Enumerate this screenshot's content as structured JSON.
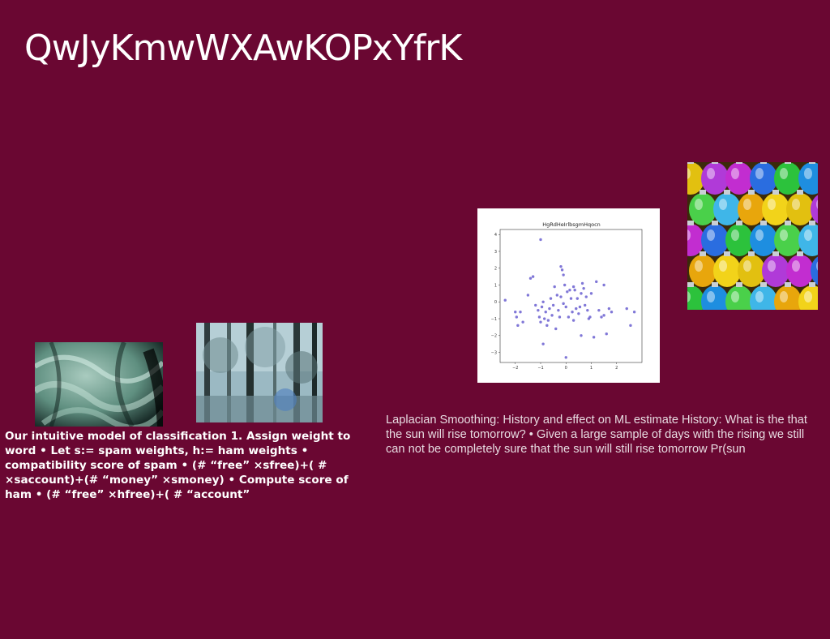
{
  "slide": {
    "title": "QwJyKmwWXAwKOPxYfrK",
    "text_left": "Our intuitive model of classification 1. Assign weight to word • Let s:= spam weights, h:= ham weights • compatibility score of spam • (# “free” ×sfree)+( # ×saccount)+(# “money” ×smoney) • Compute score of ham • (# “free” ×hfree)+( # “account”",
    "text_right": "Laplacian Smoothing: History and effect on ML estimate History: What is the that the sun will rise tomorrow? • Given a large sample of days with the rising we still can not be completely sure that the sun will still rise tomorrow Pr(sun"
  },
  "colors": {
    "background": "#6a0732",
    "scatter_point": "#6a5fd0"
  },
  "images": {
    "fabric": "green-fabric-photo",
    "forest": "forest-photo",
    "ornaments": "colorful-ornaments-photo"
  },
  "chart_data": {
    "type": "scatter",
    "title": "HgRdHeIrlbsgmHqocn",
    "xlim": [
      -2.6,
      3.0
    ],
    "ylim": [
      -3.6,
      4.3
    ],
    "xticks": [
      -2,
      -1,
      0,
      1,
      2
    ],
    "yticks": [
      -3,
      -2,
      -1,
      0,
      1,
      2,
      3,
      4
    ],
    "x": [
      -2.4,
      -2.0,
      -1.95,
      -1.9,
      -1.8,
      -1.7,
      -1.5,
      -1.3,
      -1.2,
      -1.1,
      -1.05,
      -1.0,
      -0.95,
      -0.9,
      -0.85,
      -0.8,
      -0.75,
      -0.7,
      -0.65,
      -0.6,
      -0.55,
      -0.5,
      -0.45,
      -0.4,
      -0.35,
      -0.3,
      -0.25,
      -0.2,
      -0.15,
      -0.1,
      -0.05,
      0.0,
      0.05,
      0.1,
      0.15,
      0.2,
      0.25,
      0.3,
      0.35,
      0.4,
      0.45,
      0.5,
      0.55,
      0.6,
      0.65,
      0.7,
      0.75,
      0.8,
      0.85,
      0.9,
      0.95,
      1.0,
      1.1,
      1.2,
      1.3,
      1.4,
      1.5,
      1.6,
      1.7,
      1.8,
      2.4,
      2.55,
      2.7,
      -1.0,
      -0.2,
      0.0,
      -0.9,
      0.6,
      1.5,
      -0.1,
      0.3,
      -1.4
    ],
    "y": [
      0.1,
      -0.6,
      -0.9,
      -1.4,
      -0.6,
      -1.2,
      0.4,
      1.5,
      -0.2,
      -0.5,
      -0.9,
      -1.2,
      -0.3,
      0.0,
      -1.0,
      -0.6,
      -1.4,
      -1.1,
      -0.4,
      0.2,
      -0.8,
      -0.2,
      0.9,
      -1.6,
      0.4,
      -0.5,
      -0.9,
      0.3,
      1.9,
      -0.1,
      1.0,
      -0.3,
      0.6,
      -0.9,
      0.7,
      0.2,
      -0.6,
      -1.1,
      0.7,
      -0.4,
      0.2,
      -0.7,
      -0.3,
      0.5,
      1.1,
      0.8,
      -0.2,
      0.3,
      -0.5,
      -1.0,
      -0.9,
      0.5,
      -2.1,
      1.2,
      -0.5,
      -0.9,
      -0.8,
      -1.9,
      -0.4,
      -0.6,
      -0.4,
      -1.4,
      -0.6,
      3.7,
      2.1,
      -3.3,
      -2.5,
      -2.0,
      1.0,
      1.6,
      0.9,
      1.4
    ]
  }
}
